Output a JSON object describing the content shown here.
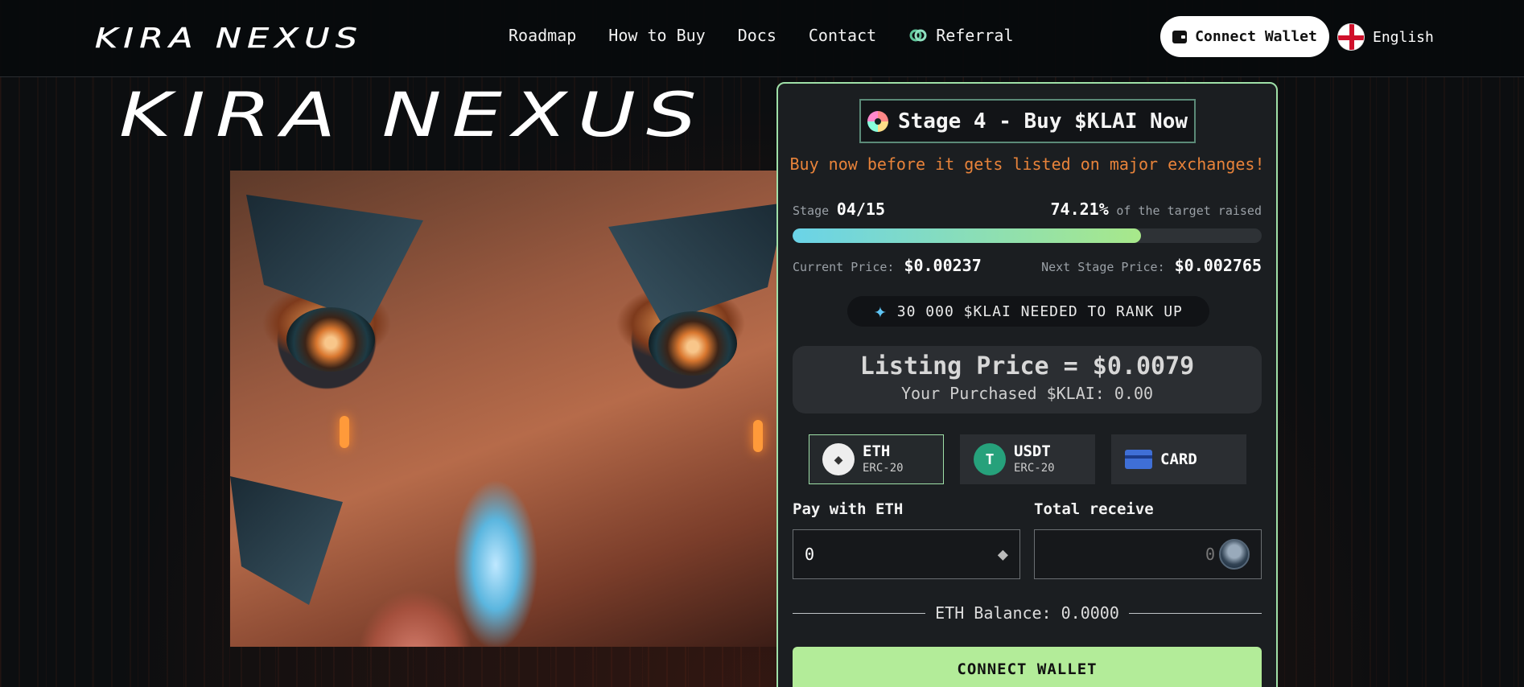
{
  "header": {
    "logo": "KIRA NEXUS",
    "nav": [
      "Roadmap",
      "How to Buy",
      "Docs",
      "Contact"
    ],
    "referral": "Referral",
    "connect_wallet": "Connect Wallet",
    "language": "English"
  },
  "hero": {
    "title": "KIRA NEXUS"
  },
  "panel": {
    "stage_title": "Stage 4 - Buy $KLAI Now",
    "hurry_text": "Buy now before it gets listed on major exchanges!",
    "stage_label": "Stage",
    "stage_value": "04/15",
    "raised_percent": "74.21%",
    "raised_label": "of the target raised",
    "progress_fraction": 0.7421,
    "current_price_label": "Current Price:",
    "current_price": "$0.00237",
    "next_price_label": "Next Stage Price:",
    "next_price": "$0.002765",
    "rank_up": "30 000 $KLAI NEEDED TO RANK UP",
    "listing_price": "Listing Price = $0.0079",
    "purchased": "Your Purchased $KLAI: 0.00",
    "tokens": [
      {
        "name": "ETH",
        "sub": "ERC-20",
        "icon": "eth-icon",
        "active": true
      },
      {
        "name": "USDT",
        "sub": "ERC-20",
        "icon": "usdt-icon",
        "active": false
      },
      {
        "name": "CARD",
        "sub": "",
        "icon": "card-icon",
        "active": false
      }
    ],
    "pay_label": "Pay with ETH",
    "pay_value": "0",
    "receive_label": "Total receive",
    "receive_value": "0",
    "balance": "ETH Balance: 0.0000",
    "connect_button": "CONNECT WALLET"
  },
  "colors": {
    "accent": "#9fe0a8",
    "cta": "#b3ec99",
    "warning_text": "#e8833a",
    "referral": "#8ec9b0"
  }
}
